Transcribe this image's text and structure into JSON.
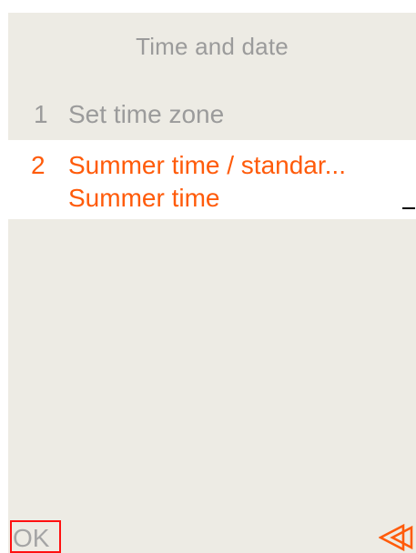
{
  "header": {
    "title": "Time and date"
  },
  "menu": {
    "items": [
      {
        "number": "1",
        "label": "Set time zone",
        "selected": false
      },
      {
        "number": "2",
        "label": "Summer time / standar...",
        "value": "Summer time",
        "selected": true
      }
    ]
  },
  "footer": {
    "ok_label": "OK",
    "back_icon": "double-back-arrow-icon"
  },
  "colors": {
    "background": "#edebe4",
    "selected_background": "#ffffff",
    "accent": "#ff5b0a",
    "inactive_text": "#9b9b9b",
    "ok_highlight": "#ff1010"
  }
}
